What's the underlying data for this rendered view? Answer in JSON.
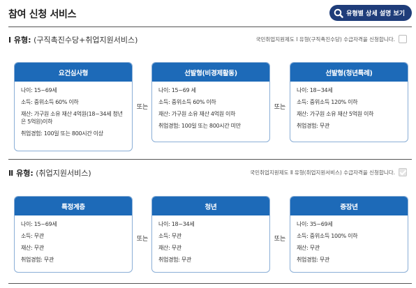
{
  "page": {
    "title": "참여 신청 서비스",
    "guide_button": "유형별 상세 설명 보기"
  },
  "type1": {
    "label": "Ⅰ 유형:",
    "sub": "(구직촉진수당+취업지원서비스)",
    "check_text": "국민취업지원제도 Ⅰ 유형(구직촉진수당) 수급자격을 신청합니다.",
    "checked": false,
    "or_label": "또는",
    "cards": [
      {
        "title": "요건심사형",
        "lines": [
          "나이: 15~69세",
          "소득: 중위소득 60% 이하",
          "재산: 가구원 소유 재산 4억원(18~34세 청년은 5억원)이하",
          "취업경험: 100일 또는 800시간 이상"
        ]
      },
      {
        "title": "선발형(비경제활동)",
        "lines": [
          "나이: 15~69 세",
          "소득: 중위소득 60% 이하",
          "재산: 가구원 소유 재산 4억원 이하",
          "취업경험: 100일 또는 800시간 미만"
        ]
      },
      {
        "title": "선발형(청년특례)",
        "lines": [
          "나이: 18~34세",
          "소득: 중위소득 120% 이하",
          "재산: 가구원 소유 재산 5억원 이하",
          "취업경험: 무관"
        ]
      }
    ]
  },
  "type2": {
    "label": "Ⅱ 유형:",
    "sub": "(취업지원서비스)",
    "check_text": "국민취업지원제도 Ⅱ 유형(취업지원서비스) 수급자격을 신청합니다.",
    "checked": false,
    "or_label": "또는",
    "cards": [
      {
        "title": "특정계층",
        "lines": [
          "나이: 15~69세",
          "소득: 무관",
          "재산: 무관",
          "취업경험: 무관"
        ]
      },
      {
        "title": "청년",
        "lines": [
          "나이: 18~34세",
          "소득: 무관",
          "재산: 무관",
          "취업경험: 무관"
        ]
      },
      {
        "title": "중장년",
        "lines": [
          "나이: 35~69세",
          "소득: 중위소득 100% 이하",
          "재산: 무관",
          "취업경험: 무관"
        ]
      }
    ]
  },
  "colors": {
    "header_bg": "#1d6ab8",
    "button_bg": "#1f3d7a",
    "card_border": "#8aaed6"
  },
  "icons": {
    "guide": "magnifier-icon",
    "checkbox": "checkbox"
  }
}
